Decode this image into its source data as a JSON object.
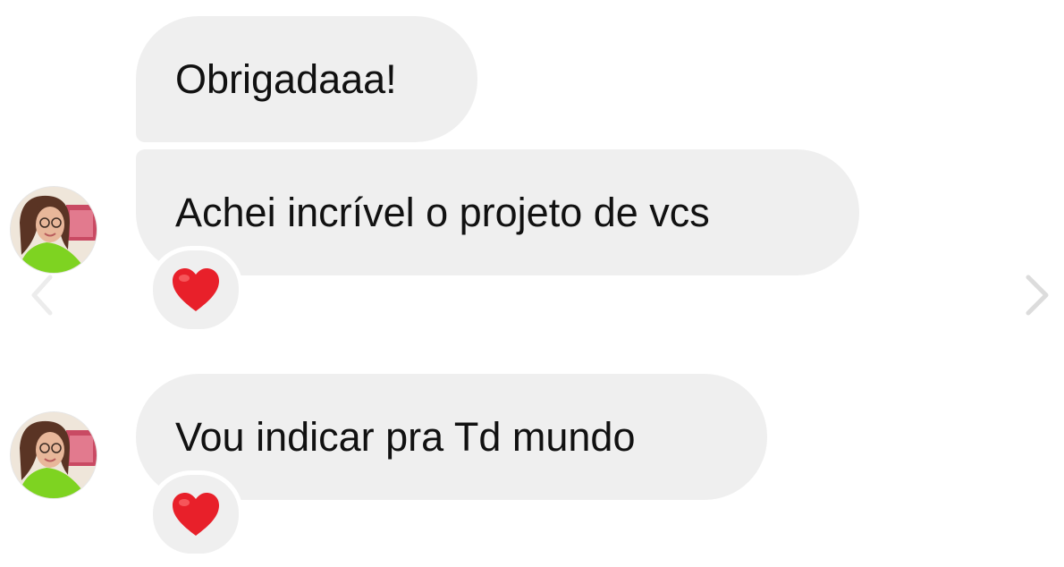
{
  "messages": [
    {
      "text": "Obrigadaaa!"
    },
    {
      "text": "Achei incrível o projeto de vcs",
      "reaction": "heart-emoji"
    },
    {
      "text": "Vou indicar pra Td mundo",
      "reaction": "heart-emoji"
    }
  ],
  "navigation": {
    "prev_icon": "chevron-left-icon",
    "next_icon": "chevron-right-icon"
  },
  "colors": {
    "bubble": "#efefef",
    "text": "#111111",
    "heart": "#e8202a",
    "arrow": "#dcdcdc",
    "avatar_shirt": "#7ed321"
  }
}
